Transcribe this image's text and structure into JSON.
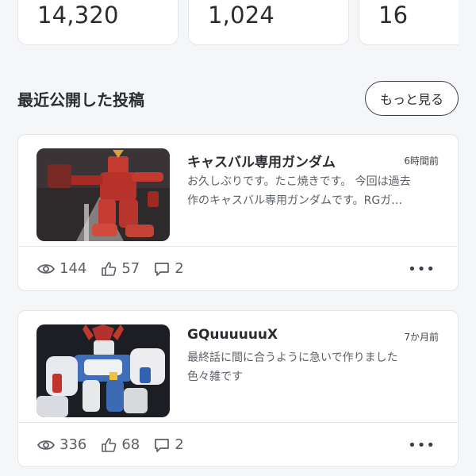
{
  "stats": [
    {
      "value": "14,320"
    },
    {
      "value": "1,024"
    },
    {
      "value": "16"
    }
  ],
  "section": {
    "title": "最近公開した投稿",
    "more_label": "もっと見る"
  },
  "posts": [
    {
      "title": "キャスバル専用ガンダム",
      "time": "6時間前",
      "excerpt": "お久しぶりです。たこ焼きです。 今回は過去\n作のキャスバル専用ガンダムです。RGガ…",
      "views": "144",
      "likes": "57",
      "comments": "2",
      "thumb_icon": "red-gundam-model-photo"
    },
    {
      "title": "GQuuuuuuX",
      "time": "7か月前",
      "excerpt": "最終話に間に合うように急いで作りました\n色々雑です",
      "views": "336",
      "likes": "68",
      "comments": "2",
      "thumb_icon": "white-blue-gundam-model-photo"
    }
  ],
  "icons": {
    "views": "eye-icon",
    "likes": "thumbs-up-icon",
    "comments": "comment-icon",
    "more": "more-dots-icon"
  },
  "colors": {
    "background": "#f5f6f8",
    "card": "#ffffff",
    "text": "#2a2c30",
    "muted": "#5b5f66"
  }
}
